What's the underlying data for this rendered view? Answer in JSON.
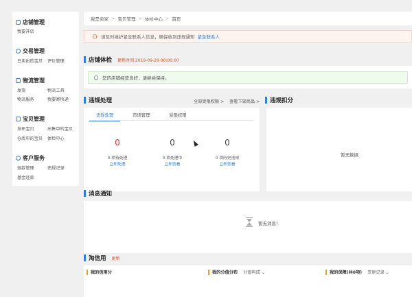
{
  "sidebar": {
    "sections": [
      {
        "title": "店铺管理",
        "links": [
          "我要开店"
        ]
      },
      {
        "title": "交易管理",
        "links": [
          "已卖出的宝贝",
          "评价管理"
        ]
      },
      {
        "title": "物流管理",
        "links": [
          "发货",
          "物流工具",
          "物流服务",
          "我要寄快递"
        ]
      },
      {
        "title": "宝贝管理",
        "links": [
          "发布宝贝",
          "出售中的宝贝",
          "仓库中的宝贝",
          "体检中心"
        ]
      },
      {
        "title": "客户服务",
        "links": [
          "退款管理",
          "违规记录",
          "基金还款"
        ]
      }
    ]
  },
  "breadcrumb": {
    "items": [
      "我是卖家",
      "宝贝管理",
      "体检中心",
      "首页"
    ],
    "sep": ">"
  },
  "notice": {
    "text": "请及时维护紧急联系人信息，确保收到违规通知",
    "link": "紧急联系人"
  },
  "shop_check": {
    "title": "店铺体检",
    "updated": "更新时间 2019-09-29 00:00:00",
    "message": "您的店铺经营良好，请继续保持。"
  },
  "violation": {
    "title": "违规处理",
    "link_appeal": "全部受限权限 >",
    "link_goods": "查看下架商品 >",
    "tabs": [
      "违规处理",
      "市场管理",
      "受限权限"
    ],
    "stats": [
      {
        "value": "0",
        "label": "0 项待处理",
        "action": "立即处理"
      },
      {
        "value": "0",
        "label": "0 项处理中",
        "action": "立即查看"
      },
      {
        "value": "0",
        "label": "0 项历史违规",
        "action": "立即查看"
      }
    ]
  },
  "penalty": {
    "title": "违规扣分",
    "empty": "暂无数据"
  },
  "messages": {
    "title": "消息通知",
    "empty": "暂无消息！"
  },
  "credit": {
    "title": "淘信用",
    "sub": "更新",
    "items": [
      {
        "label": "我的信用分",
        "extra": ""
      },
      {
        "label": "我的分值分布",
        "extra": "分值构成 ⌄"
      },
      {
        "label": "我的保障(共0项)",
        "extra": "变更记录 ⌄"
      }
    ]
  },
  "colors": {
    "accent": "#2f7fd8",
    "alert": "#e2312c",
    "highlight": "#e0501e"
  }
}
